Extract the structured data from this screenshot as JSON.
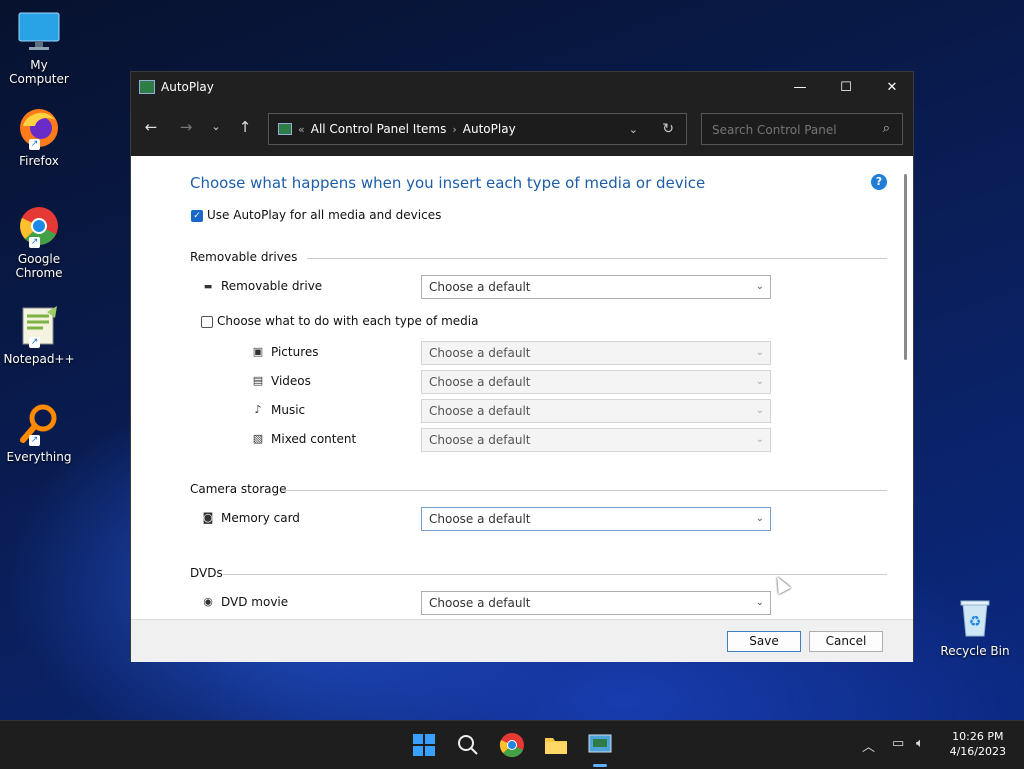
{
  "desktop": {
    "icons": [
      {
        "label": "My Computer"
      },
      {
        "label": "Firefox"
      },
      {
        "label": "Google Chrome"
      },
      {
        "label": "Notepad++"
      },
      {
        "label": "Everything"
      },
      {
        "label": "Recycle Bin"
      }
    ]
  },
  "window": {
    "title": "AutoPlay",
    "controls": {
      "minimize": "—",
      "maximize": "☐",
      "close": "✕"
    },
    "address": {
      "overflow": "«",
      "crumbs": [
        "All Control Panel Items",
        "AutoPlay"
      ]
    },
    "search": {
      "placeholder": "Search Control Panel"
    },
    "heading": "Choose what happens when you insert each type of media or device",
    "use_autoplay": {
      "label": "Use AutoPlay for all media and devices",
      "checked": true
    },
    "sections": {
      "removable": {
        "title": "Removable drives",
        "drive": {
          "label": "Removable drive",
          "value": "Choose a default"
        },
        "each_media": {
          "label": "Choose what to do with each type of media",
          "checked": false
        },
        "media": [
          {
            "label": "Pictures",
            "value": "Choose a default"
          },
          {
            "label": "Videos",
            "value": "Choose a default"
          },
          {
            "label": "Music",
            "value": "Choose a default"
          },
          {
            "label": "Mixed content",
            "value": "Choose a default"
          }
        ]
      },
      "camera": {
        "title": "Camera storage",
        "memory_card": {
          "label": "Memory card",
          "value": "Choose a default"
        }
      },
      "dvds": {
        "title": "DVDs",
        "dvd_movie": {
          "label": "DVD movie",
          "value": "Choose a default"
        }
      }
    },
    "footer": {
      "save": "Save",
      "cancel": "Cancel"
    }
  },
  "taskbar": {
    "clock": {
      "time": "10:26 PM",
      "date": "4/16/2023"
    }
  }
}
